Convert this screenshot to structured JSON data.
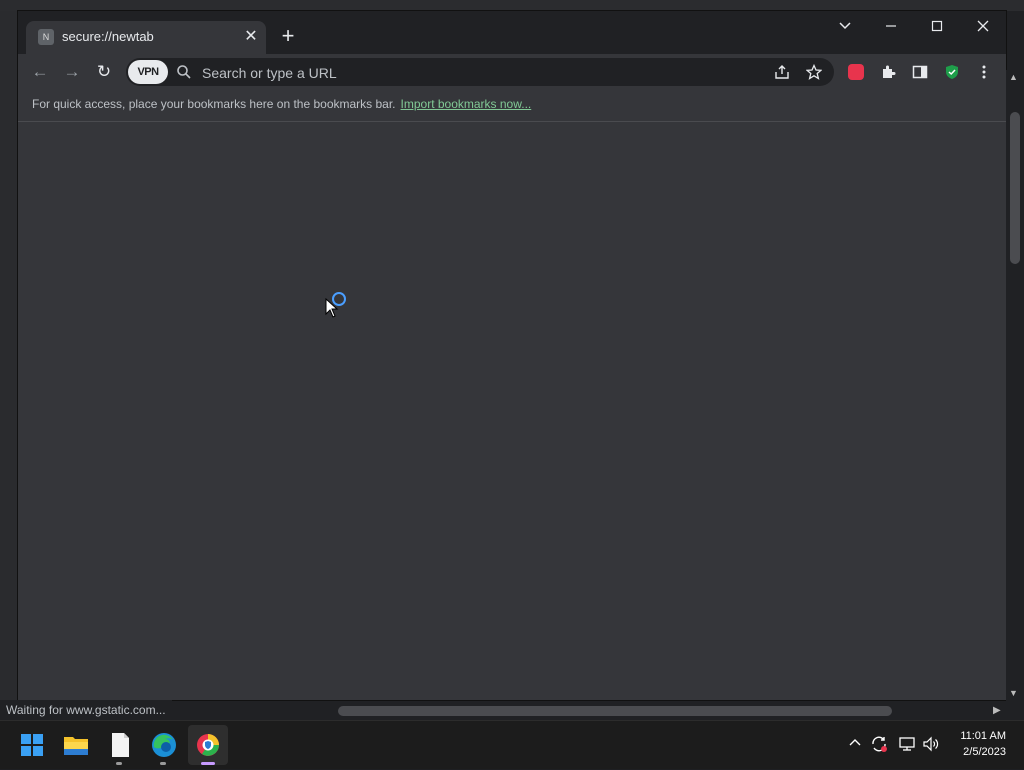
{
  "browser": {
    "tab": {
      "favicon_letter": "N",
      "title": "secure://newtab",
      "close": "✕"
    },
    "new_tab": "+",
    "window_controls": {
      "dropdown": "⌄",
      "minimize": "—",
      "maximize": "☐",
      "close": "✕"
    }
  },
  "toolbar": {
    "back": "←",
    "forward": "→",
    "reload": "↻",
    "vpn_label": "VPN",
    "omnibox_placeholder": "Search or type a URL"
  },
  "bookmarks_bar": {
    "text": "For quick access, place your bookmarks here on the bookmarks bar.",
    "link": "Import bookmarks now..."
  },
  "status_bar": {
    "text": "Waiting for www.gstatic.com..."
  },
  "taskbar": {
    "time": "11:01 AM",
    "date": "2/5/2023"
  },
  "colors": {
    "accent": "#4a9eff",
    "shield": "#1e9e4a",
    "ext_red": "#e8344d"
  }
}
